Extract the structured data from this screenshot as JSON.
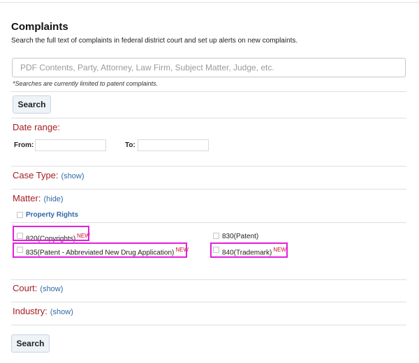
{
  "page": {
    "title": "Complaints",
    "subtitle": "Search the full text of complaints in federal district court and set up alerts on new complaints."
  },
  "search": {
    "placeholder": "PDF Contents, Party, Attorney, Law Firm, Subject Matter, Judge, etc.",
    "value": "",
    "note": "*Searches are currently limited to patent complaints.",
    "button_label": "Search"
  },
  "date_range": {
    "title": "Date range:",
    "from_label": "From:",
    "to_label": "To:",
    "from_value": "",
    "to_value": ""
  },
  "case_type": {
    "title": "Case Type:",
    "toggle": "(show)"
  },
  "matter": {
    "title": "Matter:",
    "toggle": "(hide)",
    "group_label": "Property Rights",
    "options": [
      {
        "label": "820(Copyrights)",
        "badge": "NEW",
        "checked": false
      },
      {
        "label": "830(Patent)",
        "badge": "",
        "checked": false
      },
      {
        "label": "835(Patent - Abbreviated New Drug Application)",
        "badge": "NEW",
        "checked": false
      },
      {
        "label": "840(Trademark)",
        "badge": "NEW",
        "checked": false
      }
    ]
  },
  "court": {
    "title": "Court:",
    "toggle": "(show)"
  },
  "industry": {
    "title": "Industry:",
    "toggle": "(show)"
  },
  "footer": {
    "button_label": "Search"
  },
  "colors": {
    "section_title": "#a51d21",
    "link": "#2f69a6",
    "highlight": "#e21fdd",
    "new_badge": "#c8102e"
  }
}
